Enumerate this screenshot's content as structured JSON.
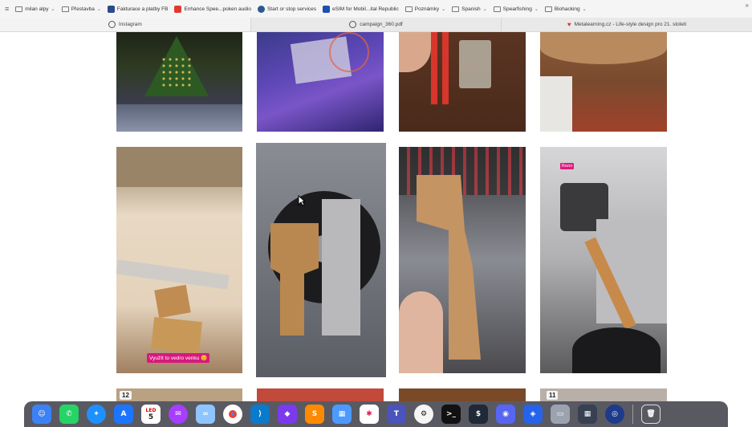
{
  "bookmarks": [
    {
      "label": "milan alpy",
      "type": "folder",
      "chevron": true
    },
    {
      "label": "Přestavba",
      "type": "folder",
      "chevron": true
    },
    {
      "label": "Fakturace a platby FB",
      "type": "site",
      "color": "#2b4b8c"
    },
    {
      "label": "Enhance Spee...poken audio",
      "type": "site",
      "color": "#e03a2f"
    },
    {
      "label": "Start or stop services",
      "type": "site",
      "color": "#2a5b8e"
    },
    {
      "label": "eSIM for Mobil...ital Republic",
      "type": "site",
      "color": "#1d4fb0"
    },
    {
      "label": "Poznámky",
      "type": "folder",
      "chevron": true
    },
    {
      "label": "Spanish",
      "type": "folder",
      "chevron": true
    },
    {
      "label": "Spearfishing",
      "type": "folder",
      "chevron": true
    },
    {
      "label": "Biohacking",
      "type": "folder",
      "chevron": true
    }
  ],
  "tabs": [
    {
      "label": "Instagram"
    },
    {
      "label": "campaign_360.pdf"
    },
    {
      "label": "Metalearning.cz - Life-style design pro 21. století"
    }
  ],
  "grid": {
    "caption_text": "Využít to vedro venku 😊",
    "badge_text": "Rozor",
    "numbers": [
      "12",
      "11"
    ]
  },
  "dock": {
    "calendar_month": "LED",
    "calendar_day": "5",
    "apps": [
      "finder",
      "whatsapp",
      "safari",
      "app-store",
      "calendar",
      "messenger",
      "finder-alt",
      "chrome",
      "vscode",
      "obsidian",
      "sublime",
      "files",
      "slack",
      "teams",
      "chatgpt",
      "terminal",
      "iterm",
      "discord",
      "cursor",
      "preview",
      "calculator",
      "screenshot",
      "trash"
    ]
  }
}
